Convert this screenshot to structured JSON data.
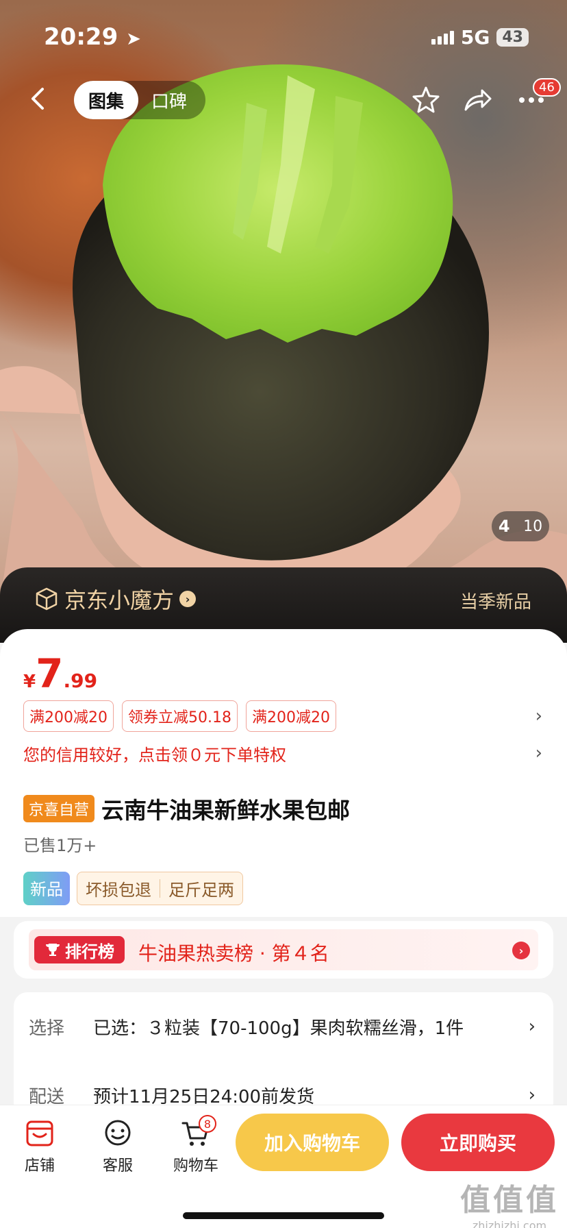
{
  "status_bar": {
    "time": "20:29",
    "network": "5G",
    "battery": "43"
  },
  "nav": {
    "tabs": [
      {
        "label": "图集",
        "active": true
      },
      {
        "label": "口碑",
        "active": false
      }
    ],
    "message_badge": "46"
  },
  "gallery": {
    "current": "4",
    "total": "10"
  },
  "promo": {
    "brand": "京东小魔方",
    "right_label": "当季新品",
    "accent": "#f1d3a5"
  },
  "price": {
    "symbol": "¥",
    "integer": "7",
    "decimal": ".99",
    "color": "#e2231a"
  },
  "coupons": [
    "满200减20",
    "领券立减50.18",
    "满200减20"
  ],
  "credit_notice": "您的信用较好，点击领０元下单特权",
  "product": {
    "badge": "京喜自营",
    "title": "云南牛油果新鲜水果包邮",
    "sold": "已售1万+"
  },
  "tags": {
    "new": "新品",
    "services": [
      "坏损包退",
      "足斤足两"
    ]
  },
  "ranking": {
    "badge": "排行榜",
    "text": "牛油果热卖榜 · 第４名"
  },
  "options": [
    {
      "label": "选择",
      "value": "已选：３粒装【70-100g】果肉软糯丝滑，1件"
    },
    {
      "label": "配送",
      "value": "预计11月25日24:00前发货"
    }
  ],
  "bottom_bar": {
    "store": "店铺",
    "service": "客服",
    "cart": "购物车",
    "cart_count": "8",
    "add_to_cart": "加入购物车",
    "buy_now": "立即购买"
  },
  "watermark": {
    "big": "值值值",
    "small": "zhizhizhi.com"
  }
}
